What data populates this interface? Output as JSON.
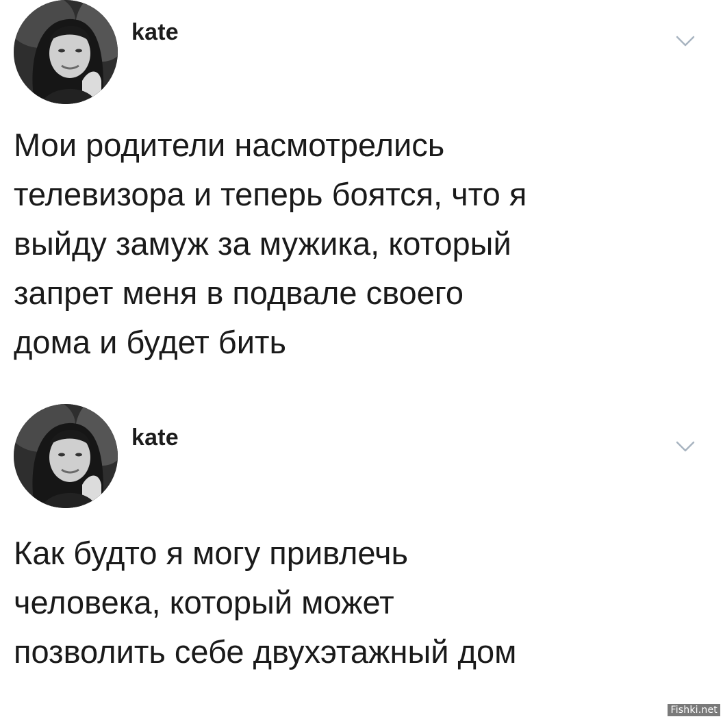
{
  "tweets": [
    {
      "username": "kate",
      "text": "Мои родители насмотрелись\nтелевизора и теперь боятся, что я\nвыйду замуж за мужика, который\nзапрет меня  в подвале своего\nдома и будет бить",
      "avatar_icon": "profile-photo",
      "menu_icon": "chevron-down-icon"
    },
    {
      "username": "kate",
      "text": "Как будто я могу привлечь\nчеловека, который может\nпозволить себе двухэтажный дом",
      "avatar_icon": "profile-photo",
      "menu_icon": "chevron-down-icon"
    }
  ],
  "watermark": "Fishki.net",
  "colors": {
    "background": "#ffffff",
    "text": "#1a1a1a",
    "chevron": "#a8b4c0"
  }
}
